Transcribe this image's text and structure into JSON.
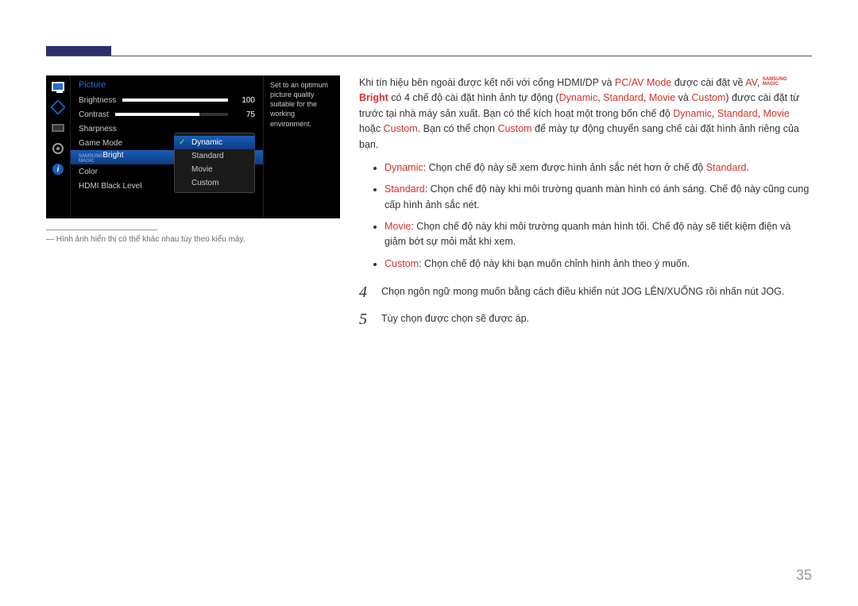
{
  "osd": {
    "title": "Picture",
    "items": {
      "brightness": {
        "label": "Brightness",
        "value": "100",
        "pct": 100
      },
      "contrast": {
        "label": "Contrast",
        "value": "75",
        "pct": 75
      },
      "sharpness": {
        "label": "Sharpness"
      },
      "game_mode": {
        "label": "Game Mode"
      },
      "magic": {
        "tiny1": "SAMSUNG",
        "tiny2": "MAGIC",
        "suffix": "Bright"
      },
      "color": {
        "label": "Color"
      },
      "hdmi": {
        "label": "HDMI Black Level"
      }
    },
    "popup": {
      "dynamic": "Dynamic",
      "standard": "Standard",
      "movie": "Movie",
      "custom": "Custom"
    },
    "desc": "Set to an optimum picture quality suitable for the working environment.",
    "icon_info_glyph": "i"
  },
  "note": {
    "dash": "―",
    "text": "Hình ảnh hiển thị có thể khác nhau tùy theo kiểu máy."
  },
  "body": {
    "p1_a": "Khi tín hiệu bên ngoài được kết nối với cổng HDMI/DP và ",
    "p1_pcav": "PC/AV Mode",
    "p1_b": " được cài đặt về ",
    "p1_av": "AV",
    "p1_c": ", ",
    "p1_magic_t1": "SAMSUNG",
    "p1_magic_t2": "MAGIC",
    "p1_magic_suffix": "Bright",
    "p1_d": " có 4 chế độ cài đặt hình ảnh tự động (",
    "p1_dynamic": "Dynamic",
    "p1_sep": ", ",
    "p1_standard": "Standard",
    "p1_movie": "Movie",
    "p1_and": " và ",
    "p1_custom": "Custom",
    "p1_e": ") được cài đặt từ trước tại nhà máy sản xuất. Bạn có thể kích hoạt một trong bốn chế độ ",
    "p1_or": " hoặc ",
    "p1_f": ". Bạn có thể chọn ",
    "p1_g": " để mày tự động chuyển sang chế cài đặt hình ảnh riêng của bạn.",
    "li1_a": "Dynamic",
    "li1_b": ": Chọn chế độ này sẽ xem được hình ảnh sắc nét hơn ở chế độ ",
    "li1_c": "Standard",
    "li1_d": ".",
    "li2_a": "Standard",
    "li2_b": ": Chọn chế độ này khi môi trường quanh màn hình có ánh sáng. Chế độ này cũng cung cấp hình ảnh sắc nét.",
    "li3_a": "Movie",
    "li3_b": ": Chọn chế độ này khi môi trường quanh màn hình tối. Chế độ này sẽ tiết kiệm điện và giảm bớt sự mỏi mắt khi xem.",
    "li4_a": "Custom",
    "li4_b": ": Chọn chế độ này khi bạn muốn chỉnh hình ảnh theo ý muốn.",
    "step4_n": "4",
    "step4": "Chọn ngôn ngữ mong muốn bằng cách điều khiển nút JOG LÊN/XUỐNG rồi nhấn nút JOG.",
    "step5_n": "5",
    "step5": "Tùy chọn được chọn sẽ được áp."
  },
  "page": "35"
}
